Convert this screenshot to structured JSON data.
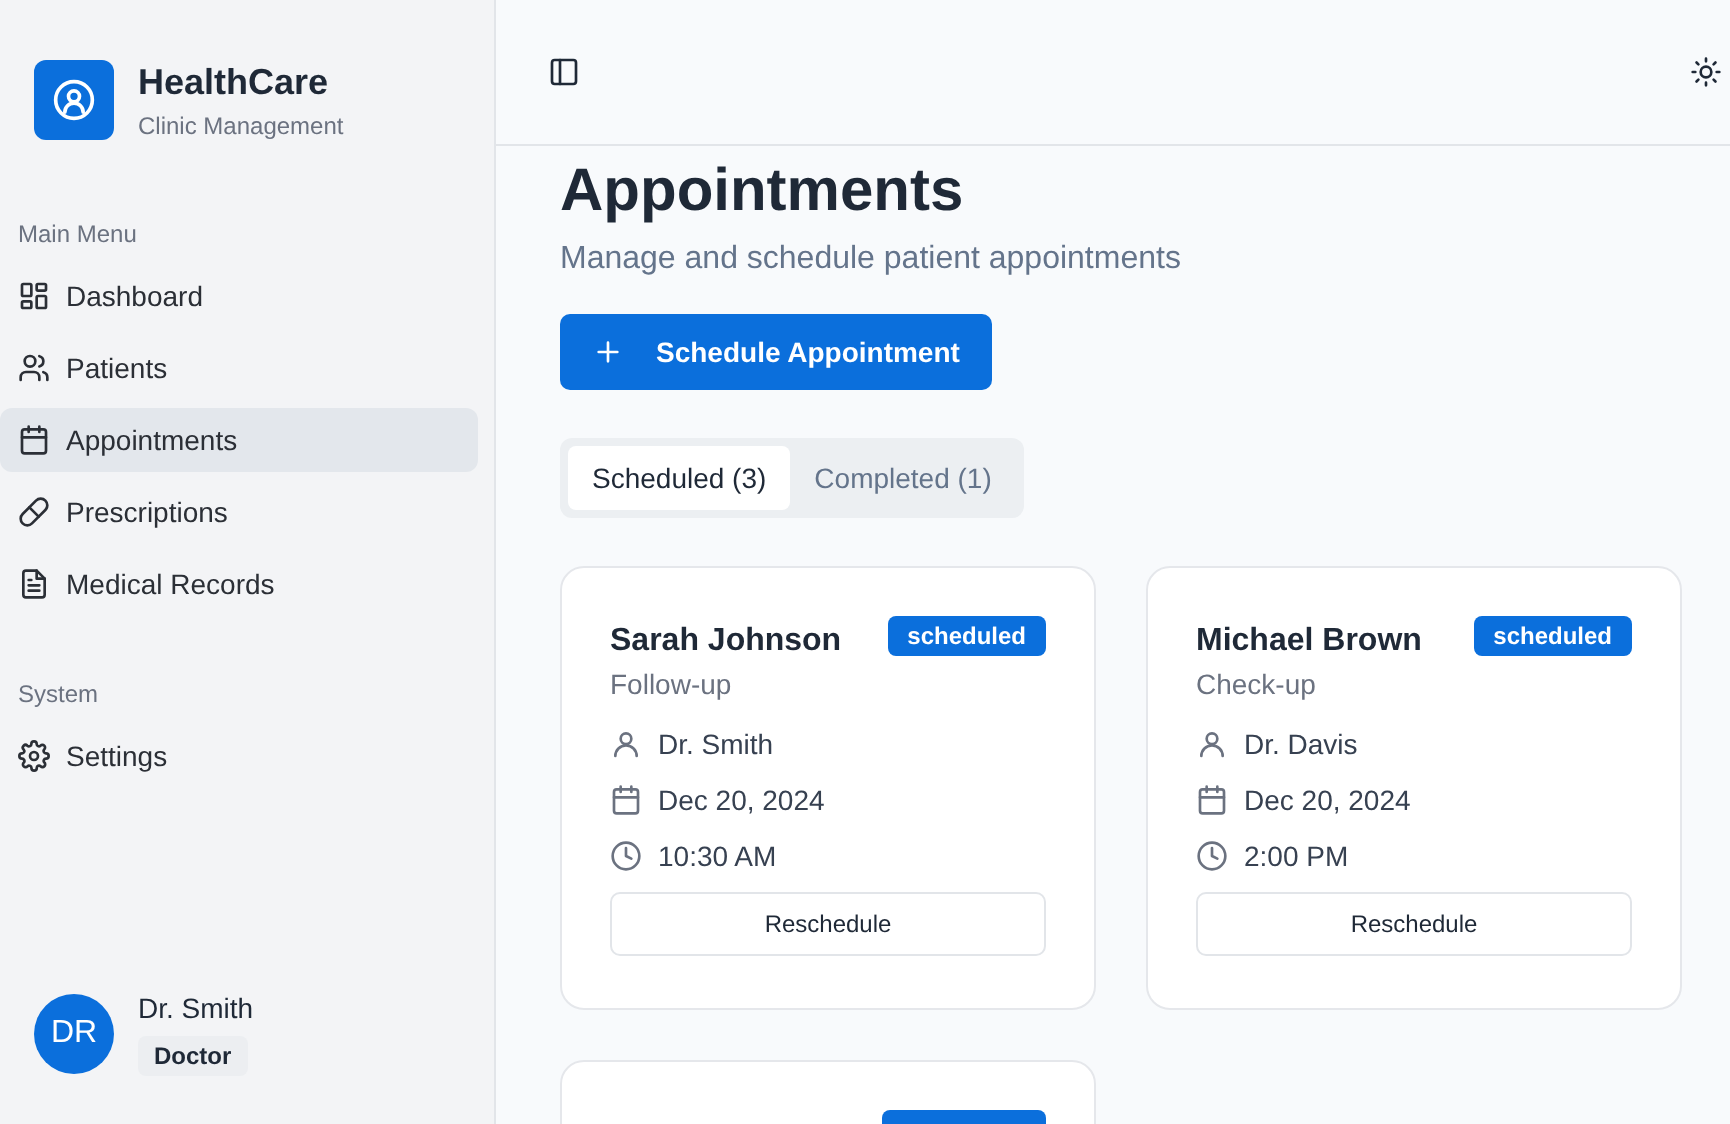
{
  "brand": {
    "title": "HealthCare",
    "subtitle": "Clinic Management"
  },
  "sidebar": {
    "sections": [
      {
        "heading": "Main Menu",
        "items": [
          {
            "kind": "grid",
            "label": "Dashboard",
            "selected": false
          },
          {
            "kind": "users",
            "label": "Patients",
            "selected": false
          },
          {
            "kind": "calendar",
            "label": "Appointments",
            "selected": true
          },
          {
            "kind": "pill",
            "label": "Prescriptions",
            "selected": false
          },
          {
            "kind": "file",
            "label": "Medical Records",
            "selected": false
          }
        ]
      },
      {
        "heading": "System",
        "items": [
          {
            "kind": "gear",
            "label": "Settings",
            "selected": false
          }
        ]
      }
    ],
    "user": {
      "initials": "DR",
      "name": "Dr. Smith",
      "role": "Doctor"
    }
  },
  "page": {
    "title": "Appointments",
    "subtitle": "Manage and schedule patient appointments",
    "primary_button": "Schedule Appointment",
    "tabs": [
      {
        "label": "Scheduled (3)",
        "selected": true
      },
      {
        "label": "Completed (1)",
        "selected": false
      }
    ]
  },
  "appointments": [
    {
      "kind": "full",
      "patient": "Sarah Johnson",
      "type": "Follow-up",
      "status": "scheduled",
      "doctor": "Dr. Smith",
      "date": "Dec 20, 2024",
      "time": "10:30 AM",
      "action": "Reschedule"
    },
    {
      "kind": "full",
      "patient": "Michael Brown",
      "type": "Check-up",
      "status": "scheduled",
      "doctor": "Dr. Davis",
      "date": "Dec 20, 2024",
      "time": "2:00 PM",
      "action": "Reschedule"
    },
    {
      "kind": "partial"
    }
  ]
}
